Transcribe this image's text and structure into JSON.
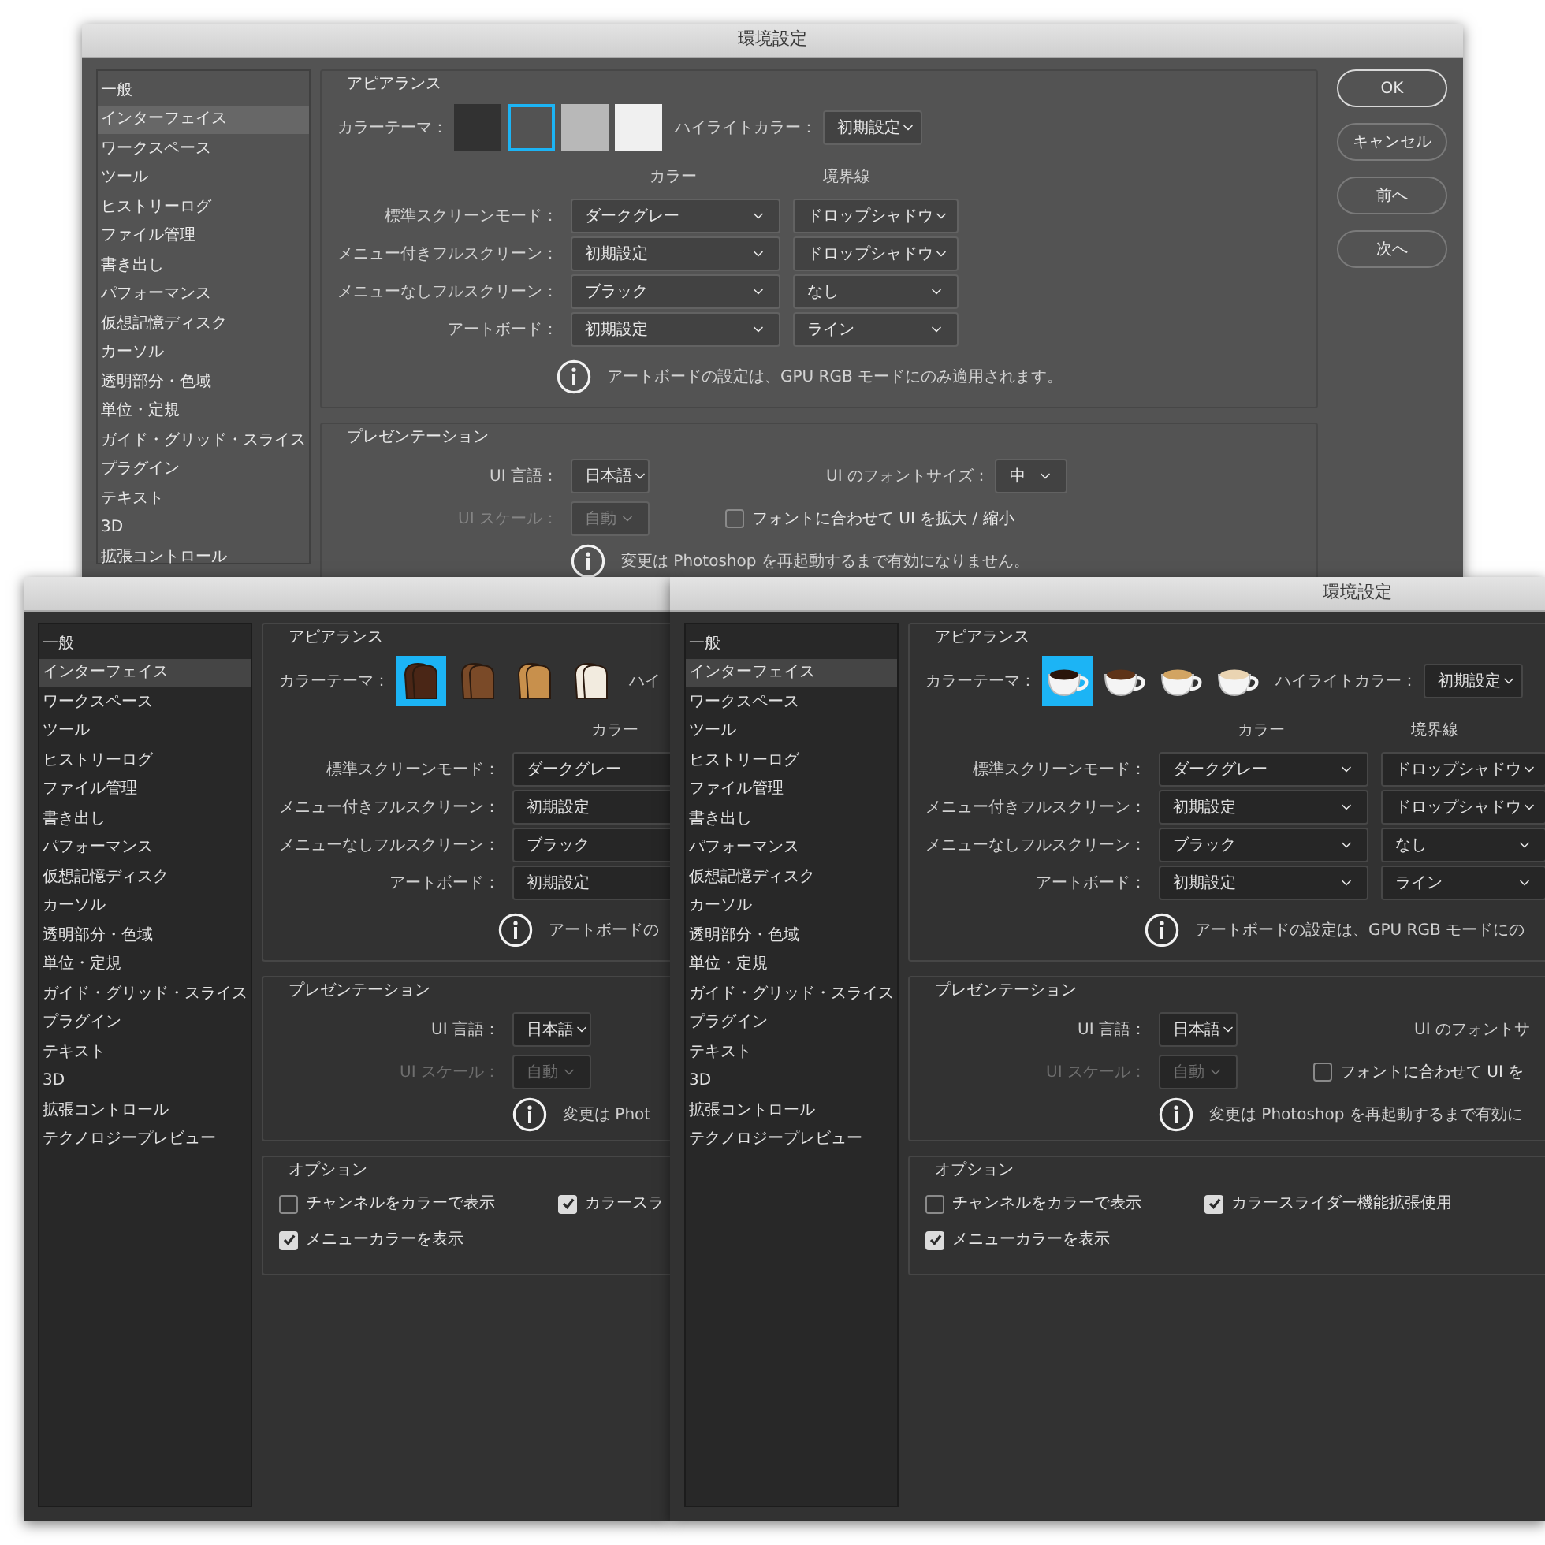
{
  "windows": [
    {
      "kind": "medium",
      "title": "環境設定",
      "sidebar": [
        {
          "label": "一般",
          "selected": false
        },
        {
          "label": "インターフェイス",
          "selected": true
        },
        {
          "label": "ワークスペース",
          "selected": false
        },
        {
          "label": "ツール",
          "selected": false
        },
        {
          "label": "ヒストリーログ",
          "selected": false
        },
        {
          "label": "ファイル管理",
          "selected": false
        },
        {
          "label": "書き出し",
          "selected": false
        },
        {
          "label": "パフォーマンス",
          "selected": false
        },
        {
          "label": "仮想記憶ディスク",
          "selected": false
        },
        {
          "label": "カーソル",
          "selected": false
        },
        {
          "label": "透明部分・色域",
          "selected": false
        },
        {
          "label": "単位・定規",
          "selected": false
        },
        {
          "label": "ガイド・グリッド・スライス",
          "selected": false
        },
        {
          "label": "プラグイン",
          "selected": false
        },
        {
          "label": "テキスト",
          "selected": false
        },
        {
          "label": "3D",
          "selected": false
        },
        {
          "label": "拡張コントロール",
          "selected": false
        }
      ],
      "buttons": [
        {
          "label": "OK",
          "default": true
        },
        {
          "label": "キャンセル",
          "default": false
        },
        {
          "label": "前へ",
          "default": false
        },
        {
          "label": "次へ",
          "default": false
        }
      ],
      "appearance": {
        "heading": "アピアランス",
        "theme_label": "カラーテーマ：",
        "swatches": [
          {
            "kind": "swatch",
            "color": "#323232",
            "selected": false
          },
          {
            "kind": "swatch",
            "color": "#535353",
            "selected": true
          },
          {
            "kind": "swatch",
            "color": "#b8b8b8",
            "selected": false
          },
          {
            "kind": "swatch",
            "color": "#f0f0f0",
            "selected": false
          }
        ],
        "highlight_label": "ハイライトカラー：",
        "highlight_value": "初期設定",
        "columns": [
          "カラー",
          "境界線"
        ],
        "rows": [
          {
            "label": "標準スクリーンモード：",
            "color_value": "ダークグレー",
            "border_value": "ドロップシャドウ"
          },
          {
            "label": "メニュー付きフルスクリーン：",
            "color_value": "初期設定",
            "border_value": "ドロップシャドウ"
          },
          {
            "label": "メニューなしフルスクリーン：",
            "color_value": "ブラック",
            "border_value": "なし"
          },
          {
            "label": "アートボード：",
            "color_value": "初期設定",
            "border_value": "ライン"
          }
        ],
        "info": "アートボードの設定は、GPU RGB モードにのみ適用されます。"
      },
      "presentation": {
        "heading": "プレゼンテーション",
        "language_label": "UI 言語：",
        "language_value": "日本語",
        "font_size_label": "UI のフォントサイズ：",
        "font_size_value": "中",
        "scale_label": "UI スケール：",
        "scale_value": "自動",
        "scale_disabled": true,
        "scale_checkbox": {
          "label": "フォントに合わせて UI を拡大 / 縮小",
          "checked": false
        },
        "info": "変更は Photoshop を再起動するまで有効になりません。"
      }
    },
    {
      "kind": "dark",
      "sidebar": [
        {
          "label": "一般",
          "selected": false
        },
        {
          "label": "インターフェイス",
          "selected": true
        },
        {
          "label": "ワークスペース",
          "selected": false
        },
        {
          "label": "ツール",
          "selected": false
        },
        {
          "label": "ヒストリーログ",
          "selected": false
        },
        {
          "label": "ファイル管理",
          "selected": false
        },
        {
          "label": "書き出し",
          "selected": false
        },
        {
          "label": "パフォーマンス",
          "selected": false
        },
        {
          "label": "仮想記憶ディスク",
          "selected": false
        },
        {
          "label": "カーソル",
          "selected": false
        },
        {
          "label": "透明部分・色域",
          "selected": false
        },
        {
          "label": "単位・定規",
          "selected": false
        },
        {
          "label": "ガイド・グリッド・スライス",
          "selected": false
        },
        {
          "label": "プラグイン",
          "selected": false
        },
        {
          "label": "テキスト",
          "selected": false
        },
        {
          "label": "3D",
          "selected": false
        },
        {
          "label": "拡張コントロール",
          "selected": false
        },
        {
          "label": "テクノロジープレビュー",
          "selected": false
        }
      ],
      "appearance": {
        "heading": "アピアランス",
        "theme_label": "カラーテーマ：",
        "swatches": [
          {
            "kind": "toast",
            "color": "#4a2616",
            "selected": true
          },
          {
            "kind": "toast",
            "color": "#7a4a28",
            "selected": false
          },
          {
            "kind": "toast",
            "color": "#c8904c",
            "selected": false
          },
          {
            "kind": "toast",
            "color": "#f2ebdf",
            "selected": false
          }
        ],
        "highlight_label": "ハイ",
        "columns": [
          "カラー"
        ],
        "rows": [
          {
            "label": "標準スクリーンモード：",
            "color_value": "ダークグレー"
          },
          {
            "label": "メニュー付きフルスクリーン：",
            "color_value": "初期設定"
          },
          {
            "label": "メニューなしフルスクリーン：",
            "color_value": "ブラック"
          },
          {
            "label": "アートボード：",
            "color_value": "初期設定"
          }
        ],
        "info": "アートボードの"
      },
      "presentation": {
        "heading": "プレゼンテーション",
        "language_label": "UI 言語：",
        "language_value": "日本語",
        "scale_label": "UI スケール：",
        "scale_value": "自動",
        "scale_disabled": true,
        "info": "変更は Phot"
      },
      "options": {
        "heading": "オプション",
        "items": [
          {
            "label": "チャンネルをカラーで表示",
            "checked": false
          },
          {
            "label": "カラースラ",
            "checked": true
          },
          {
            "label": "メニューカラーを表示",
            "checked": true
          }
        ]
      }
    },
    {
      "kind": "dark",
      "title": "環境設定",
      "sidebar": [
        {
          "label": "一般",
          "selected": false
        },
        {
          "label": "インターフェイス",
          "selected": true
        },
        {
          "label": "ワークスペース",
          "selected": false
        },
        {
          "label": "ツール",
          "selected": false
        },
        {
          "label": "ヒストリーログ",
          "selected": false
        },
        {
          "label": "ファイル管理",
          "selected": false
        },
        {
          "label": "書き出し",
          "selected": false
        },
        {
          "label": "パフォーマンス",
          "selected": false
        },
        {
          "label": "仮想記憶ディスク",
          "selected": false
        },
        {
          "label": "カーソル",
          "selected": false
        },
        {
          "label": "透明部分・色域",
          "selected": false
        },
        {
          "label": "単位・定規",
          "selected": false
        },
        {
          "label": "ガイド・グリッド・スライス",
          "selected": false
        },
        {
          "label": "プラグイン",
          "selected": false
        },
        {
          "label": "テキスト",
          "selected": false
        },
        {
          "label": "3D",
          "selected": false
        },
        {
          "label": "拡張コントロール",
          "selected": false
        },
        {
          "label": "テクノロジープレビュー",
          "selected": false
        }
      ],
      "appearance": {
        "heading": "アピアランス",
        "theme_label": "カラーテーマ：",
        "swatches": [
          {
            "kind": "coffee",
            "color": "#2a150b",
            "selected": true
          },
          {
            "kind": "coffee",
            "color": "#5e3318",
            "selected": false
          },
          {
            "kind": "coffee",
            "color": "#d2a462",
            "selected": false
          },
          {
            "kind": "coffee",
            "color": "#ead4b2",
            "selected": false
          }
        ],
        "highlight_label": "ハイライトカラー：",
        "highlight_value": "初期設定",
        "columns": [
          "カラー",
          "境界線"
        ],
        "rows": [
          {
            "label": "標準スクリーンモード：",
            "color_value": "ダークグレー",
            "border_value": "ドロップシャドウ"
          },
          {
            "label": "メニュー付きフルスクリーン：",
            "color_value": "初期設定",
            "border_value": "ドロップシャドウ"
          },
          {
            "label": "メニューなしフルスクリーン：",
            "color_value": "ブラック",
            "border_value": "なし"
          },
          {
            "label": "アートボード：",
            "color_value": "初期設定",
            "border_value": "ライン"
          }
        ],
        "info": "アートボードの設定は、GPU RGB モードにの"
      },
      "presentation": {
        "heading": "プレゼンテーション",
        "language_label": "UI 言語：",
        "language_value": "日本語",
        "font_size_label": "UI のフォントサ",
        "scale_label": "UI スケール：",
        "scale_value": "自動",
        "scale_disabled": true,
        "scale_checkbox": {
          "label": "フォントに合わせて UI を",
          "checked": false
        },
        "info": "変更は Photoshop を再起動するまで有効に"
      },
      "options": {
        "heading": "オプション",
        "items": [
          {
            "label": "チャンネルをカラーで表示",
            "checked": false
          },
          {
            "label": "カラースライダー機能拡張使用",
            "checked": true
          },
          {
            "label": "メニューカラーを表示",
            "checked": true
          }
        ]
      }
    }
  ]
}
